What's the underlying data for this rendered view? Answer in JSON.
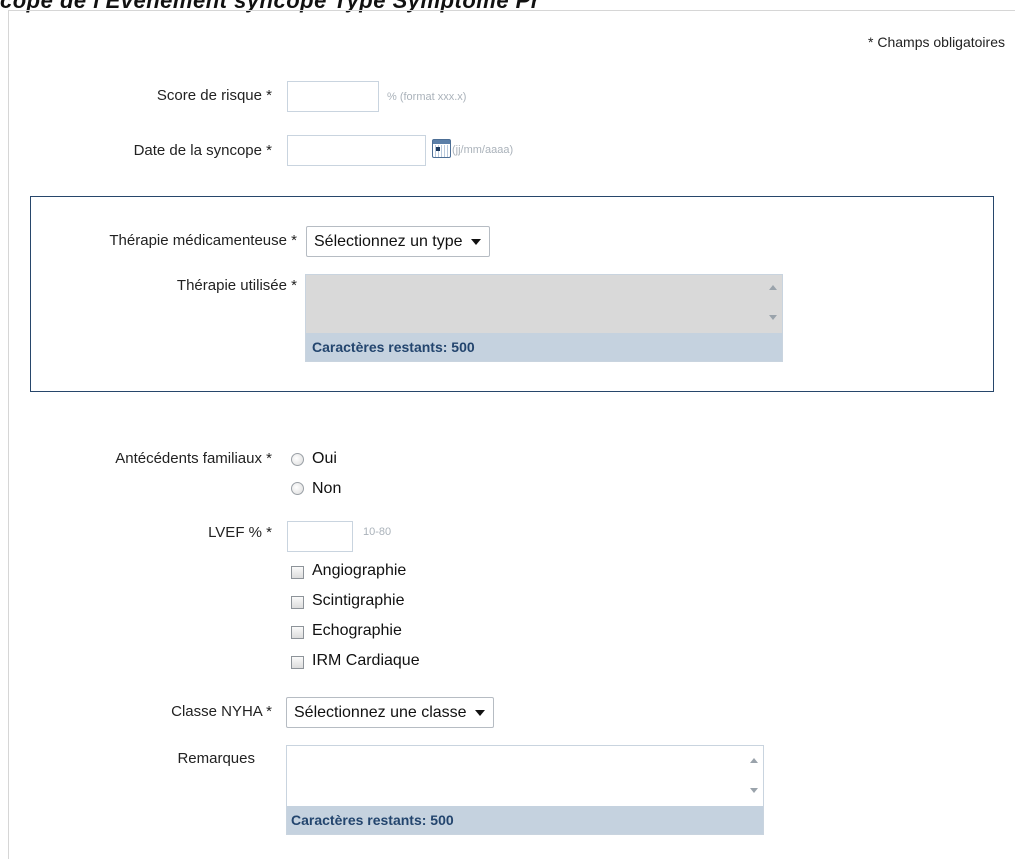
{
  "header": {
    "title": "cope de l'Evenement syncope Type Symptôme Pr",
    "required_note": "* Champs obligatoires"
  },
  "fields": {
    "risk_score": {
      "label": "Score de risque *",
      "value": "",
      "hint": "% (format xxx.x)"
    },
    "syncope_date": {
      "label": "Date de la syncope *",
      "value": "",
      "hint": "(jj/mm/aaaa)",
      "icon": "calendar-icon"
    },
    "drug_therapy": {
      "label": "Thérapie médicamenteuse *",
      "selected": "Sélectionnez un type"
    },
    "therapy_used": {
      "label": "Thérapie utilisée *",
      "value": "",
      "counter": "Caractères restants: 500"
    },
    "family_history": {
      "label": "Antécédents familiaux *",
      "options": [
        "Oui",
        "Non"
      ]
    },
    "lvef": {
      "label": "LVEF % *",
      "value": "",
      "hint": "10-80"
    },
    "imaging": {
      "options": [
        "Angiographie",
        "Scintigraphie",
        "Echographie",
        "IRM Cardiaque"
      ]
    },
    "nyha_class": {
      "label": "Classe NYHA *",
      "selected": "Sélectionnez une classe"
    },
    "remarks": {
      "label": "Remarques",
      "value": "",
      "counter": "Caractères restants: 500"
    }
  },
  "colors": {
    "box_border": "#27466b",
    "counter_bg": "#c5d2df",
    "counter_text": "#23456e",
    "therapy_disabled_bg": "#d9d9d9",
    "input_border": "#c9d4df"
  }
}
